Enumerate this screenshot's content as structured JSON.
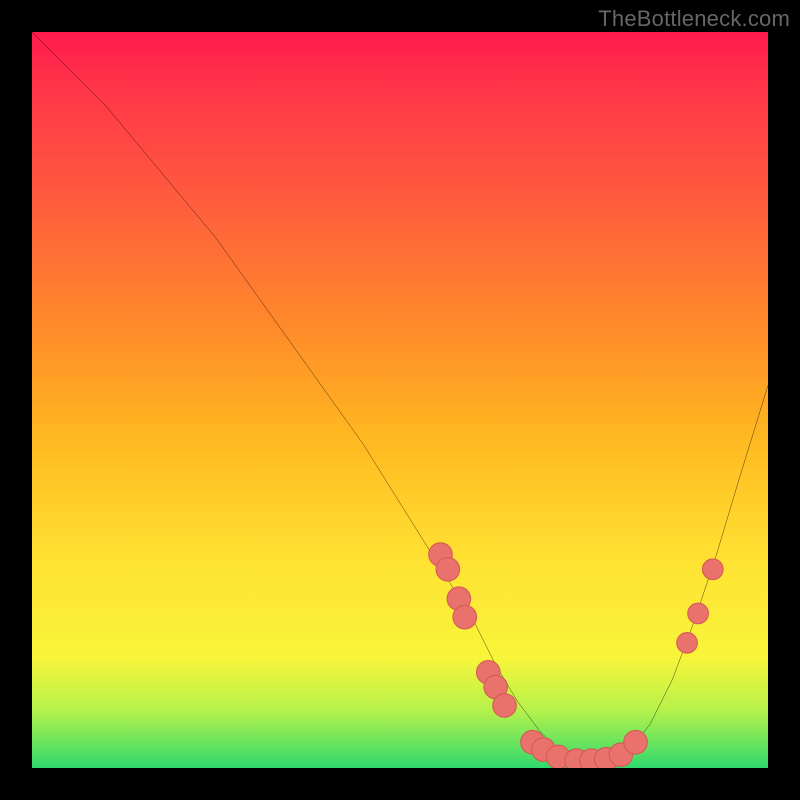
{
  "watermark": "TheBottleneck.com",
  "chart_data": {
    "type": "line",
    "title": "",
    "xlabel": "",
    "ylabel": "",
    "xlim": [
      0,
      100
    ],
    "ylim": [
      0,
      100
    ],
    "series": [
      {
        "name": "bottleneck-curve",
        "x": [
          0,
          5,
          10,
          15,
          20,
          25,
          30,
          35,
          40,
          45,
          50,
          55,
          60,
          63,
          66,
          69,
          72,
          75,
          78,
          81,
          84,
          87,
          90,
          93,
          96,
          100
        ],
        "y": [
          100,
          95,
          90,
          84,
          78,
          72,
          65,
          58,
          51,
          44,
          36,
          28,
          20,
          14,
          9,
          5,
          2,
          1,
          1,
          2,
          6,
          12,
          20,
          29,
          39,
          52
        ]
      }
    ],
    "markers": [
      {
        "name": "pt-a",
        "x": 55.5,
        "y": 29,
        "r": 1.6
      },
      {
        "name": "pt-b",
        "x": 56.5,
        "y": 27,
        "r": 1.6
      },
      {
        "name": "pt-c",
        "x": 58.0,
        "y": 23,
        "r": 1.6
      },
      {
        "name": "pt-c2",
        "x": 58.8,
        "y": 20.5,
        "r": 1.6
      },
      {
        "name": "pt-d",
        "x": 62.0,
        "y": 13,
        "r": 1.6
      },
      {
        "name": "pt-e",
        "x": 63.0,
        "y": 11,
        "r": 1.6
      },
      {
        "name": "pt-e2",
        "x": 64.2,
        "y": 8.5,
        "r": 1.6
      },
      {
        "name": "pt-f",
        "x": 68.0,
        "y": 3.5,
        "r": 1.6
      },
      {
        "name": "pt-f2",
        "x": 69.5,
        "y": 2.5,
        "r": 1.6
      },
      {
        "name": "pt-g",
        "x": 71.5,
        "y": 1.5,
        "r": 1.6
      },
      {
        "name": "pt-h",
        "x": 74.0,
        "y": 1.0,
        "r": 1.6
      },
      {
        "name": "pt-h2",
        "x": 76.0,
        "y": 1.0,
        "r": 1.6
      },
      {
        "name": "pt-i",
        "x": 78.0,
        "y": 1.2,
        "r": 1.6
      },
      {
        "name": "pt-i2",
        "x": 80.0,
        "y": 1.8,
        "r": 1.6
      },
      {
        "name": "pt-j",
        "x": 82.0,
        "y": 3.5,
        "r": 1.6
      },
      {
        "name": "pt-k",
        "x": 89.0,
        "y": 17,
        "r": 1.4
      },
      {
        "name": "pt-l",
        "x": 90.5,
        "y": 21,
        "r": 1.4
      },
      {
        "name": "pt-m",
        "x": 92.5,
        "y": 27,
        "r": 1.4
      }
    ],
    "colors": {
      "curve": "#000000",
      "marker_fill": "#e9736c",
      "marker_stroke": "#d55a54"
    }
  }
}
